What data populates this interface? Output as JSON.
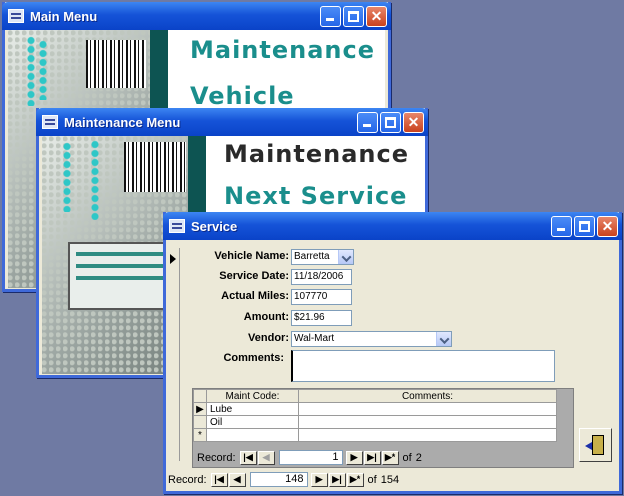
{
  "main_menu": {
    "title": "Main Menu",
    "headline_1": "Maintenance",
    "headline_2": "Vehicle"
  },
  "maint_menu": {
    "title": "Maintenance Menu",
    "headline_1": "Maintenance",
    "headline_2": "Next Service"
  },
  "service_form": {
    "title": "Service",
    "labels": {
      "vehicle_name": "Vehicle Name:",
      "service_date": "Service Date:",
      "actual_miles": "Actual Miles:",
      "amount": "Amount:",
      "vendor": "Vendor:",
      "comments": "Comments:"
    },
    "values": {
      "vehicle_name": "Barretta",
      "service_date": "11/18/2006",
      "actual_miles": "107770",
      "amount": "$21.96",
      "vendor": "Wal-Mart",
      "comments": ""
    },
    "subform": {
      "headers": [
        "Maint Code:",
        "Comments:"
      ],
      "rows": [
        {
          "code": "Lube",
          "comments": ""
        },
        {
          "code": "Oil",
          "comments": ""
        }
      ],
      "new_row_marker": "*",
      "nav": {
        "label": "Record:",
        "current": "1",
        "of_label": "of",
        "total": "2"
      }
    },
    "nav": {
      "label": "Record:",
      "current": "148",
      "of_label": "of",
      "total": "154"
    }
  },
  "colors": {
    "title_bar": "#0a43c8",
    "headline_teal": "#1a8e8c",
    "headline_dark": "#2a2a2a",
    "desktop": "#6f7aa3"
  }
}
